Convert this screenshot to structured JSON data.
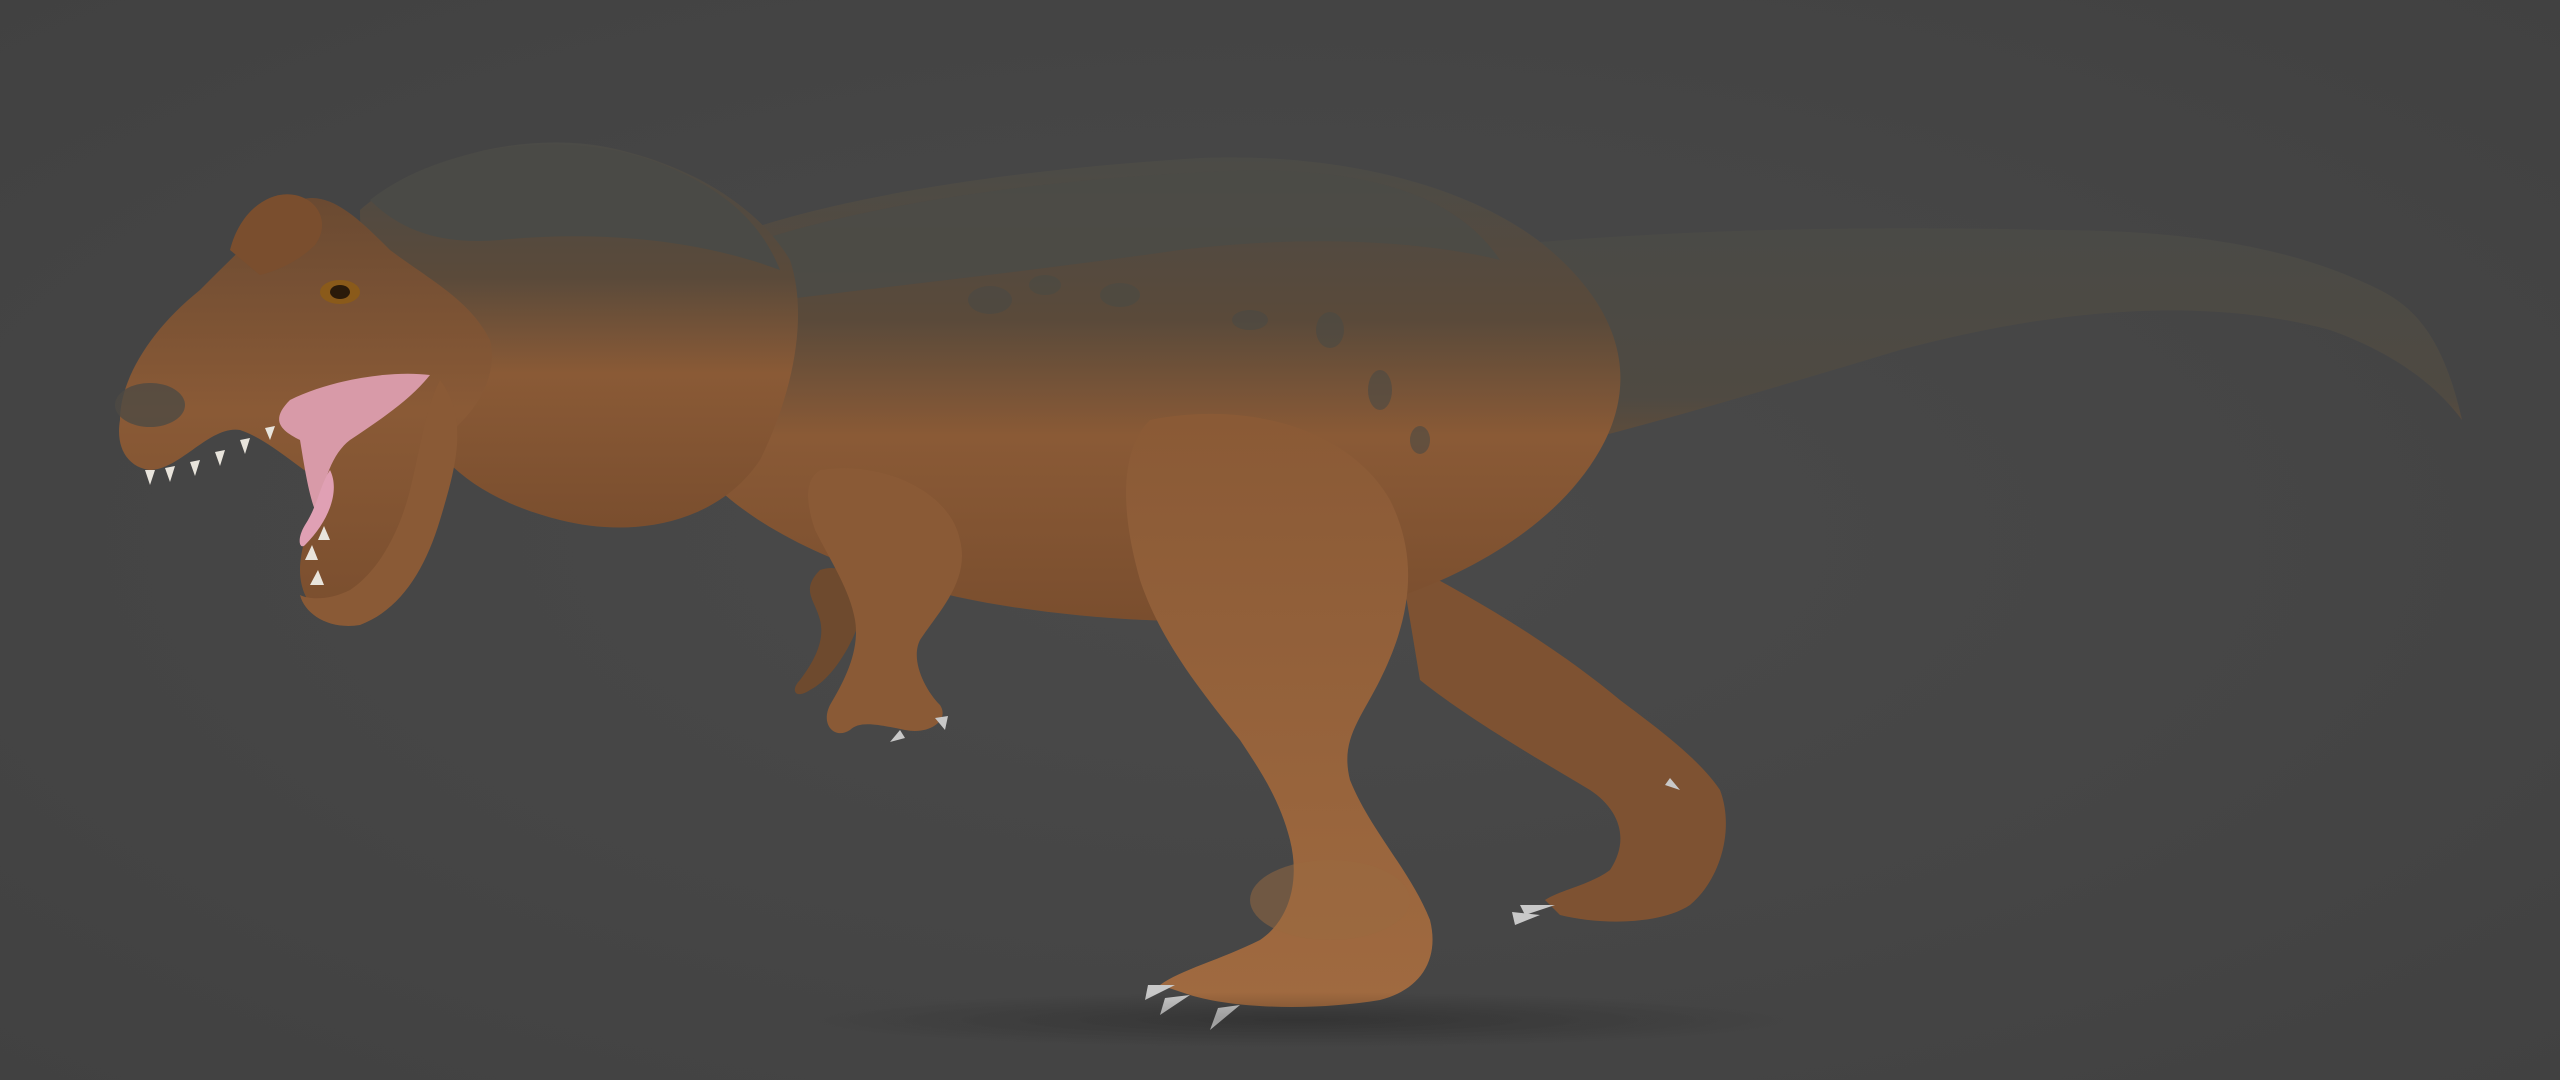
{
  "scene": {
    "subject": "dinosaur-render",
    "colors": {
      "background": "#464646",
      "skin_dark": "#4a4a46",
      "skin_brown": "#8a5a36",
      "skin_belly": "#a06a40",
      "mouth_pink": "#d89aa8",
      "teeth": "#e8e4dc",
      "claws": "#c8c8c8",
      "eye": "#8a5a1a"
    }
  }
}
